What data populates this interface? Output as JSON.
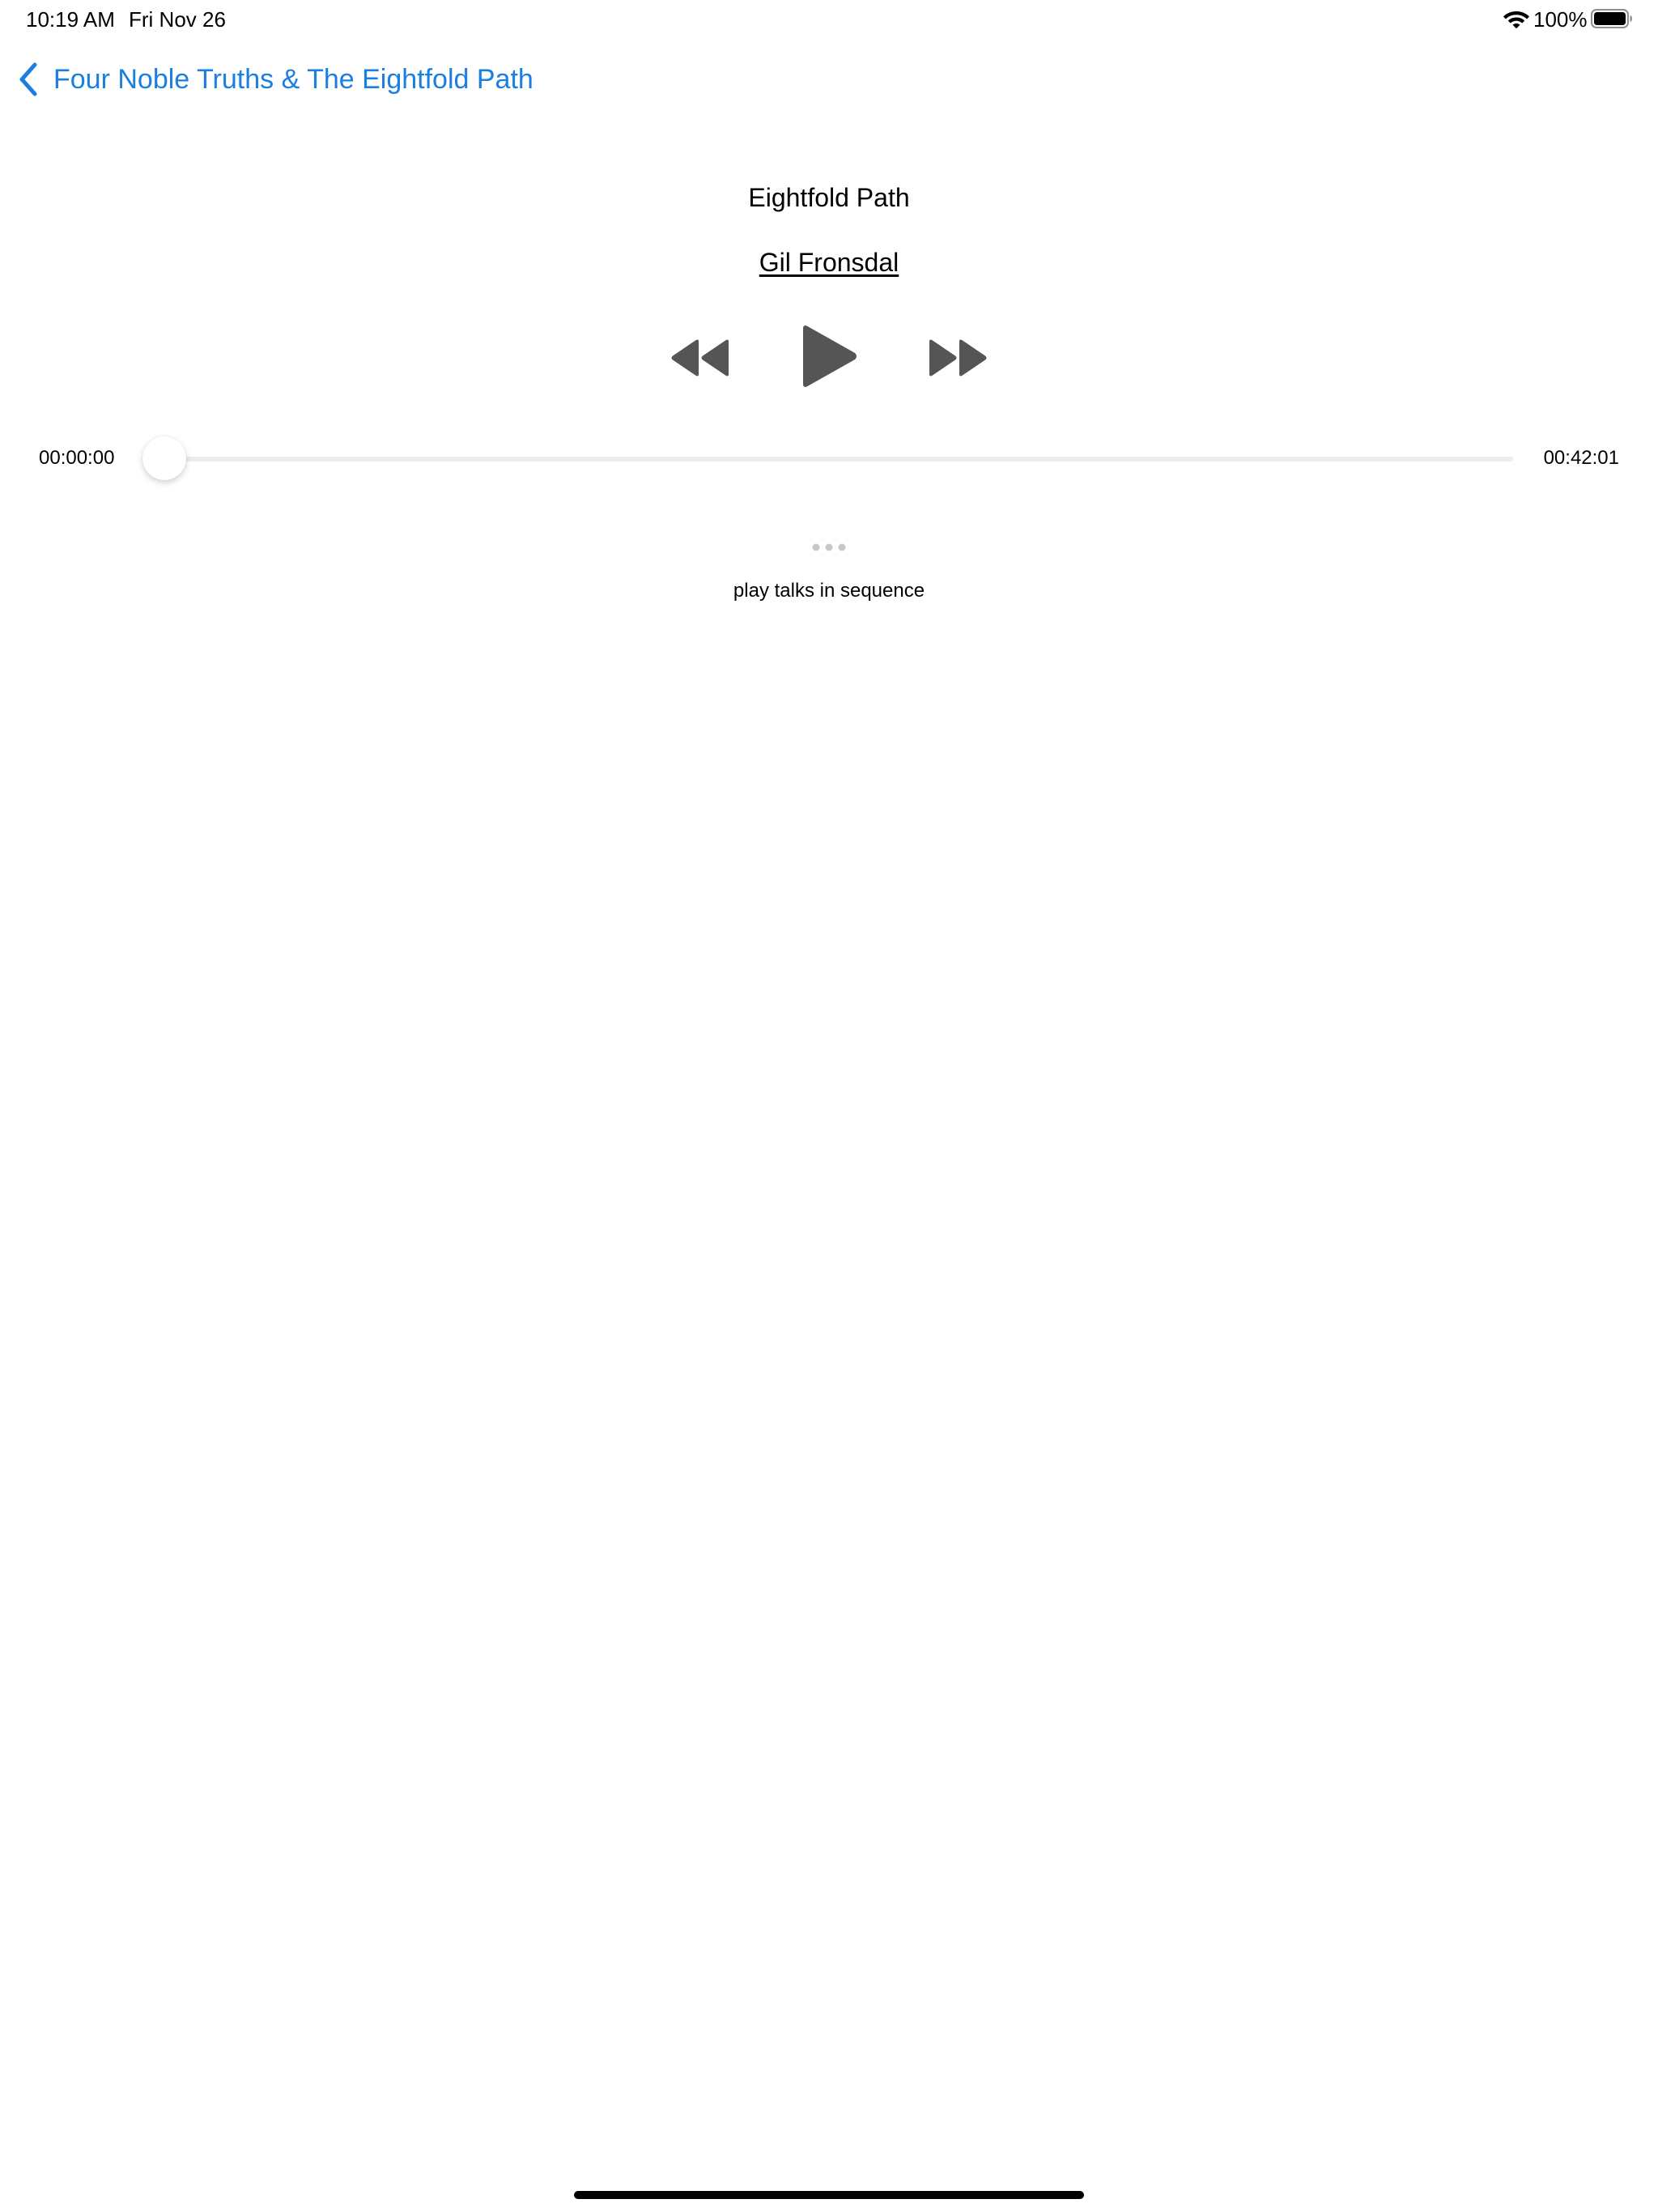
{
  "status_bar": {
    "time": "10:19 AM",
    "date": "Fri Nov 26",
    "battery_percent": "100%",
    "battery_level": 1.0,
    "wifi_icon": "wifi-icon",
    "battery_icon": "battery-icon"
  },
  "nav": {
    "back_label": "Four Noble Truths & The Eightfold Path",
    "back_icon": "chevron-left-icon",
    "accent_color": "#1a7fe0"
  },
  "talk": {
    "title": "Eightfold Path",
    "speaker": "Gil Fronsdal"
  },
  "controls": {
    "rewind_icon": "rewind-icon",
    "play_icon": "play-icon",
    "forward_icon": "fast-forward-icon",
    "icon_color": "#555555"
  },
  "playback": {
    "elapsed": "00:00:00",
    "total": "00:42:01",
    "progress": 0.0
  },
  "more": {
    "icon": "more-dots-icon",
    "sequence_label": "play talks in sequence"
  }
}
